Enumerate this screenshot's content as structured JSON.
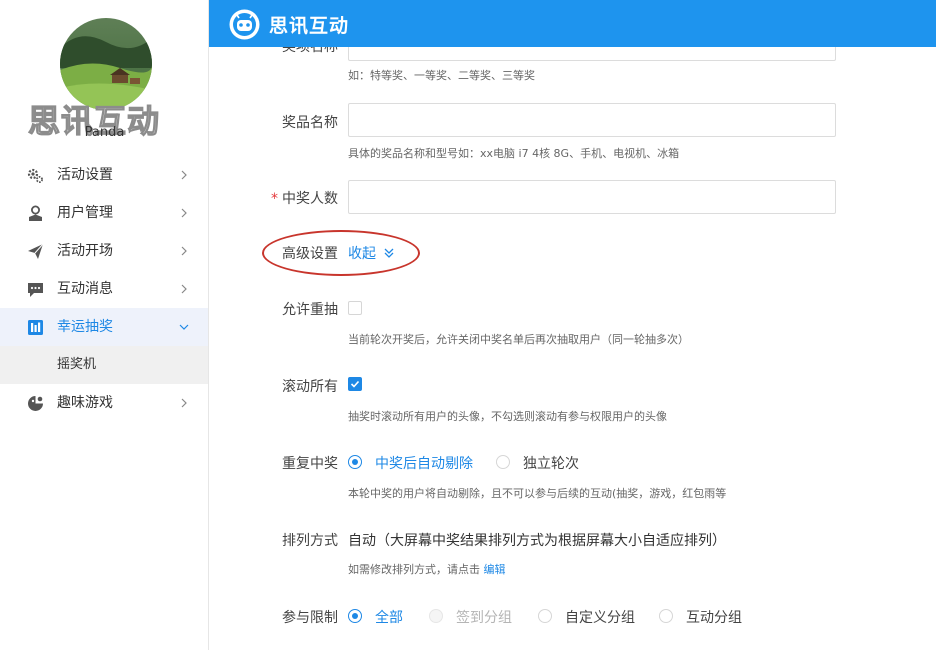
{
  "header": {
    "brand": "思讯互动",
    "logo_icon": "robot-logo-icon",
    "color": "#1e94ee"
  },
  "sidebar": {
    "watermark": "思讯互动",
    "username": "Panda",
    "items": [
      {
        "label": "活动设置",
        "icon": "gears-icon"
      },
      {
        "label": "用户管理",
        "icon": "user-icon"
      },
      {
        "label": "活动开场",
        "icon": "paper-plane-icon"
      },
      {
        "label": "互动消息",
        "icon": "chat-bubble-icon"
      },
      {
        "label": "幸运抽奖",
        "icon": "lottery-icon",
        "active": true
      },
      {
        "label": "趣味游戏",
        "icon": "game-icon"
      }
    ],
    "subitems": [
      {
        "label": "摇奖机"
      }
    ]
  },
  "form": {
    "prize_level": {
      "label": "奖项名称",
      "hint": "如：特等奖、一等奖、二等奖、三等奖",
      "value": ""
    },
    "prize_name": {
      "label": "奖品名称",
      "hint": "具体的奖品名称和型号如：xx电脑 i7 4核 8G、手机、电视机、冰箱",
      "value": ""
    },
    "winner_count": {
      "required_mark": "*",
      "label": "中奖人数",
      "value": ""
    },
    "advanced": {
      "label": "高级设置",
      "toggle": "收起"
    },
    "allow_redraw": {
      "label": "允许重抽",
      "checked": false,
      "hint": "当前轮次开奖后，允许关闭中奖名单后再次抽取用户（同一轮抽多次）"
    },
    "scroll_all": {
      "label": "滚动所有",
      "checked": true,
      "hint": "抽奖时滚动所有用户的头像，不勾选则滚动有参与权限用户的头像"
    },
    "repeat_win": {
      "label": "重复中奖",
      "options": [
        "中奖后自动剔除",
        "独立轮次"
      ],
      "selected": "中奖后自动剔除",
      "hint": "本轮中奖的用户将自动剔除，且不可以参与后续的互动(抽奖，游戏，红包雨等"
    },
    "sort_mode": {
      "label": "排列方式",
      "value": "自动（大屏幕中奖结果排列方式为根据屏幕大小自适应排列）",
      "hint": "如需修改排列方式，请点击",
      "hint_link": "编辑"
    },
    "participation": {
      "label": "参与限制",
      "options": [
        "全部",
        "签到分组",
        "自定义分组",
        "互动分组"
      ],
      "selected": "全部",
      "disabled": [
        "签到分组"
      ]
    }
  }
}
